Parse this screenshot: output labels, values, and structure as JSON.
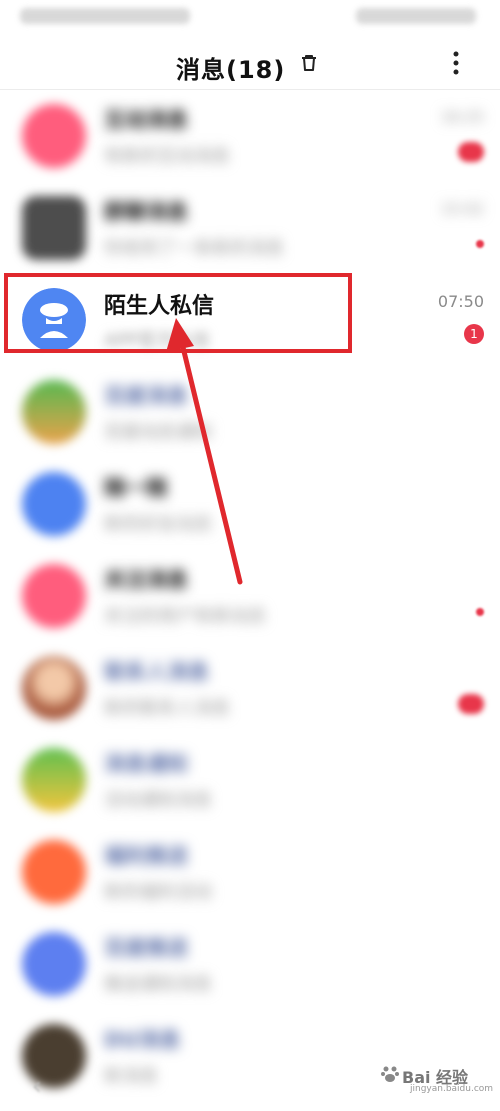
{
  "header": {
    "title": "消息(18)",
    "trash_icon": "trash-icon",
    "more_icon": "more-vertical-icon"
  },
  "list": {
    "rows": [
      {
        "name": "互动消息",
        "preview": "有新的互动消息",
        "time": "16:25",
        "badge": "",
        "avatar_color": "#ff5d7d"
      },
      {
        "name": "群聊消息",
        "preview": "你收到了一条新的消息",
        "time": "15:02",
        "badge": "",
        "avatar_color": "#4d4d4d"
      },
      {
        "name": "陌生人私信",
        "preview": "APP官方私信",
        "time": "07:50",
        "badge": "1",
        "avatar_color": "#4f86f2"
      },
      {
        "name": "百度消息",
        "preview": "百度动态通知",
        "time": "",
        "badge": "",
        "avatar_color": "#56b850"
      },
      {
        "name": "随一随",
        "preview": "新的好友动态",
        "time": "",
        "badge": "",
        "avatar_color": "#4d82f1"
      },
      {
        "name": "关注消息",
        "preview": "关注的用户有新动态",
        "time": "",
        "badge": "",
        "avatar_color": "#ff5d7d"
      },
      {
        "name": "联系人消息",
        "preview": "新的联系人消息",
        "time": "",
        "badge": "",
        "avatar_color": "#a85a3e"
      },
      {
        "name": "消息通知",
        "preview": "活动通知消息",
        "time": "",
        "badge": "",
        "avatar_color": "#5fbf4f"
      },
      {
        "name": "福利推送",
        "preview": "新的福利活动",
        "time": "",
        "badge": "",
        "avatar_color": "#ff6a3d"
      },
      {
        "name": "百度推送",
        "preview": "推送通知消息",
        "time": "",
        "badge": "",
        "avatar_color": "#5d7ff0"
      },
      {
        "name": "DU消息",
        "preview": "新消息",
        "time": "",
        "badge": "",
        "avatar_color": "#4a3e30"
      }
    ]
  },
  "watermark": {
    "text": "Bai 经验",
    "sub": "jingyan.baidu.com"
  },
  "colors": {
    "accent_red": "#e0282d",
    "badge_red": "#e8364a"
  }
}
